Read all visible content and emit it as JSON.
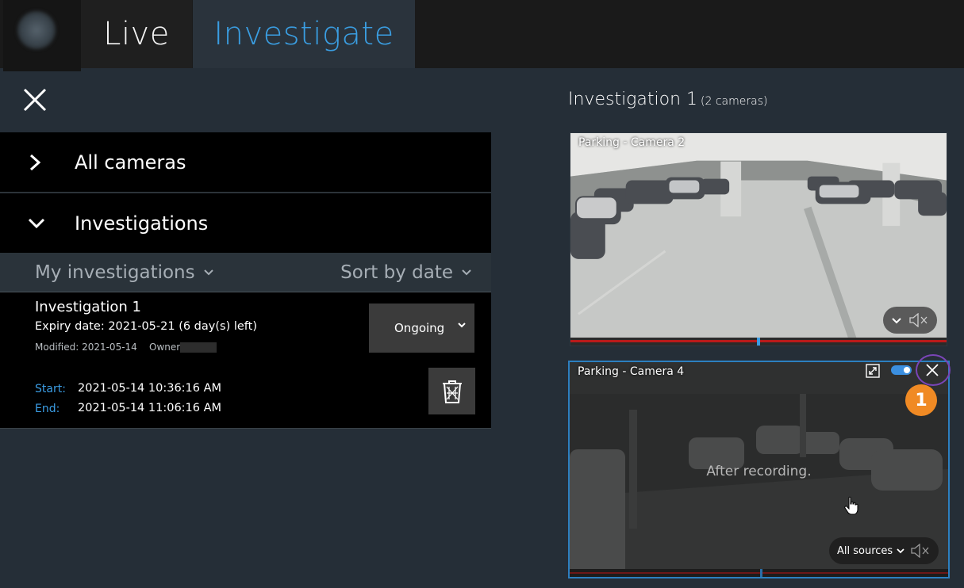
{
  "tabs": {
    "live": "Live",
    "investigate": "Investigate"
  },
  "left_panel": {
    "all_cameras": "All cameras",
    "investigations": "Investigations",
    "filter_my": "My investigations",
    "filter_sort": "Sort by date",
    "investigation": {
      "title": "Investigation 1",
      "expiry": "Expiry date: 2021-05-21 (6 day(s) left)",
      "modified": "Modified: 2021-05-14",
      "owner_label": "Owner",
      "status": "Ongoing",
      "start_label": "Start:",
      "start_value": "2021-05-14 10:36:16 AM",
      "end_label": "End:",
      "end_value": "2021-05-14 11:06:16 AM"
    }
  },
  "right_panel": {
    "title": "Investigation 1",
    "subtitle": "(2 cameras)",
    "cameras": [
      {
        "name": "Parking - Camera 2"
      },
      {
        "name": "Parking - Camera 4",
        "overlay": "After recording.",
        "sources": "All sources"
      }
    ]
  },
  "badge": "1",
  "colors": {
    "accent": "#3a9ee2",
    "selected_border": "#2c7fc0",
    "badge": "#f08a24",
    "ring": "#7a45b8"
  },
  "icons": [
    "close-icon",
    "chevron-right-icon",
    "chevron-down-icon",
    "trash-icon",
    "expand-icon",
    "toggle-icon",
    "mute-icon",
    "hand-cursor-icon"
  ]
}
